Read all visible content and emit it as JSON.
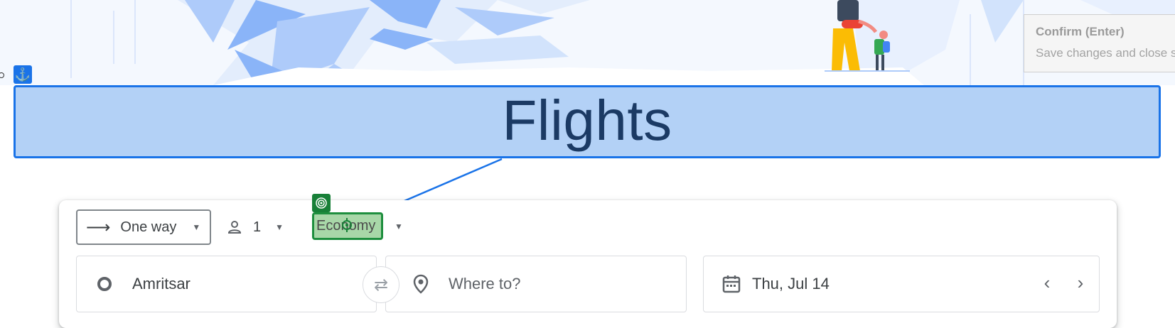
{
  "tooltip": {
    "title": "Confirm (Enter)",
    "text": "Save changes and close s"
  },
  "title": "Flights",
  "search": {
    "trip_type": "One way",
    "passengers": "1",
    "cabin_class": "Economy",
    "origin": "Amritsar",
    "destination_placeholder": "Where to?",
    "departure_date": "Thu, Jul 14"
  },
  "colors": {
    "anchor_badge": "#1a73e8",
    "title_highlight": "#b3d1f6",
    "target_badge": "#188038",
    "class_highlight": "#a8d7a8"
  }
}
